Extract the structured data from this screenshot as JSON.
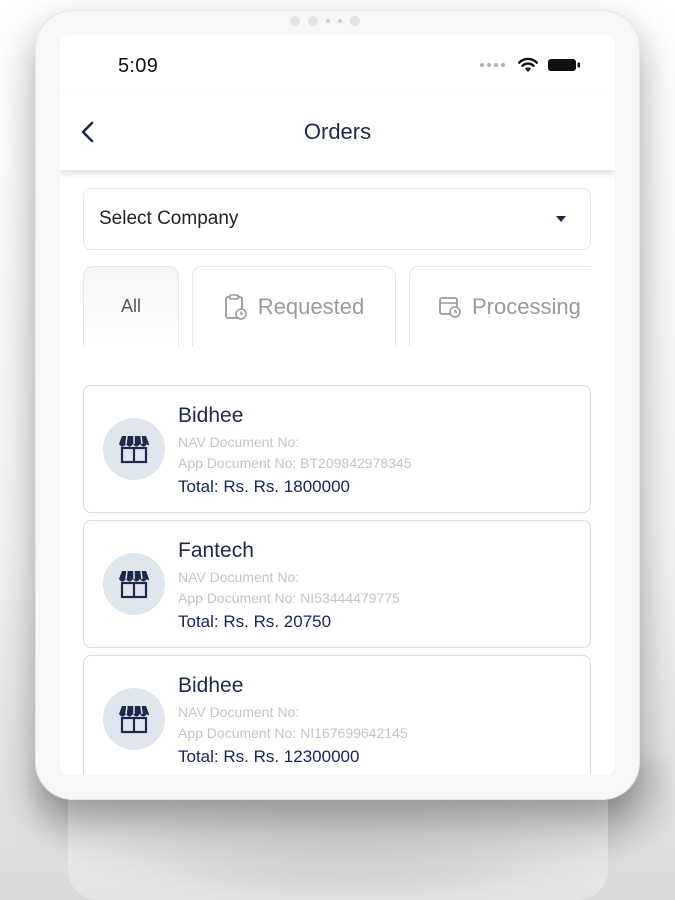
{
  "status_bar": {
    "time": "5:09"
  },
  "header": {
    "title": "Orders"
  },
  "company_select": {
    "label": "Select Company"
  },
  "tabs": [
    {
      "label": "All",
      "icon": "all"
    },
    {
      "label": "Requested",
      "icon": "clipboard-clock-icon"
    },
    {
      "label": "Processing",
      "icon": "calendar-clock-icon"
    }
  ],
  "orders": [
    {
      "name": "Bidhee",
      "nav_doc": "NAV Document No:",
      "app_doc": "App Document No: BT209842978345",
      "total": "Total: Rs. Rs. 1800000"
    },
    {
      "name": "Fantech",
      "nav_doc": "NAV Document No:",
      "app_doc": "App Document No: NI53444479775",
      "total": "Total: Rs. Rs. 20750"
    },
    {
      "name": "Bidhee",
      "nav_doc": "NAV Document No:",
      "app_doc": "App Document No: NI167699642145",
      "total": "Total: Rs. Rs. 12300000"
    }
  ],
  "colors": {
    "primary": "#1c2a4a",
    "total": "#15245a",
    "muted": "#c4c4c4",
    "avatar_bg": "#dfe6ee"
  }
}
